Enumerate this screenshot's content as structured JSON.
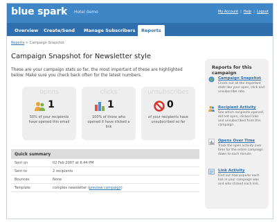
{
  "header": {
    "brand": "blue spark",
    "subtitle": "Hotel demo",
    "links": [
      "My Account",
      "Help",
      "Logout"
    ]
  },
  "nav": {
    "tabs": [
      {
        "label": "Overview"
      },
      {
        "label": "Create/Send"
      },
      {
        "label": "Manage Subscribers"
      },
      {
        "label": "Reports",
        "active": true
      }
    ]
  },
  "breadcrumb": {
    "root": "Reports",
    "separator": ">",
    "current": "Campaign Snapshot"
  },
  "main": {
    "title": "Campaign Snapshot for Newsletter style",
    "intro": "These are your campaign stats so far, the most important of these are highlighted below. Make sure you check back often for the latest numbers."
  },
  "cards": [
    {
      "heading": "opens",
      "value": "1",
      "description": "50% of your recipients have opened this email",
      "icon": "people-icon"
    },
    {
      "heading": "clicks",
      "value": "1",
      "description": "100% of those who opened it have clicked a link",
      "icon": "bar-chart-icon"
    },
    {
      "heading": "unsubscribes",
      "value": "0",
      "description": "of your recipients have unsubscribed so far",
      "icon": "no-entry-icon"
    }
  ],
  "summary": {
    "title": "Quick summary",
    "rows": [
      {
        "key": "Sent on",
        "value": "02 Feb 2007 at 6:44 PM"
      },
      {
        "key": "Sent to",
        "value": "2 recipients"
      },
      {
        "key": "Bounces",
        "value": "None"
      },
      {
        "key": "Template",
        "value": "complex newsletter",
        "link": "preview campaign"
      }
    ]
  },
  "sidebar": {
    "title": "Reports for this campaign",
    "items": [
      {
        "label": "Campaign Snapshot",
        "description": "Check out all the important stats like your open, click and unsubscribe rate.",
        "icon": "globe-icon"
      },
      {
        "label": "Recipient Activity",
        "description": "See which recipients opened, did not open, clicked links and unsubscribed from this campaign.",
        "icon": "users-icon"
      },
      {
        "label": "Opens Over Time",
        "description": "Track the open activity over time for the entire campaign down to each minute.",
        "icon": "chart-icon"
      },
      {
        "label": "Link Activity",
        "description": "Find out how popular each link in your campaign was and who clicked each link.",
        "icon": "link-icon"
      }
    ]
  },
  "colors": {
    "topbar": "#3f86c7",
    "navbar": "#2f6fad",
    "link": "#2f6fad",
    "card": "#eeeeee"
  }
}
